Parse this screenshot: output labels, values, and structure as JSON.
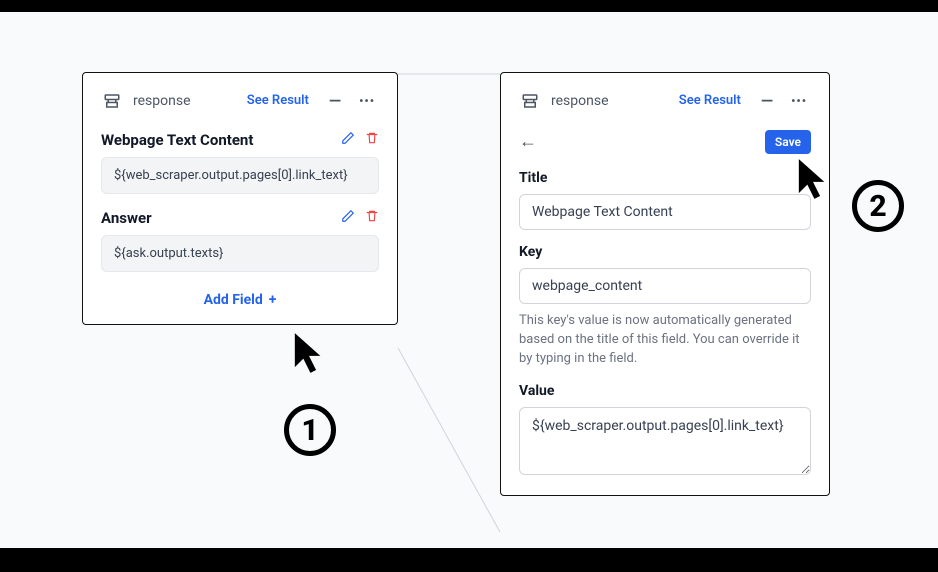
{
  "panel_left": {
    "title": "response",
    "see_result": "See Result",
    "fields": [
      {
        "title": "Webpage Text Content",
        "value": "${web_scraper.output.pages[0].link_text}"
      },
      {
        "title": "Answer",
        "value": "${ask.output.texts}"
      }
    ],
    "add_field_label": "Add Field"
  },
  "panel_right": {
    "title": "response",
    "see_result": "See Result",
    "save_label": "Save",
    "title_field": {
      "label": "Title",
      "value": "Webpage Text Content"
    },
    "key_field": {
      "label": "Key",
      "value": "webpage_content"
    },
    "key_help": "This key's value is now automatically generated based on the title of this field. You can override it by typing in the field.",
    "value_field": {
      "label": "Value",
      "value": "${web_scraper.output.pages[0].link_text}"
    }
  },
  "steps": {
    "one": "1",
    "two": "2"
  }
}
